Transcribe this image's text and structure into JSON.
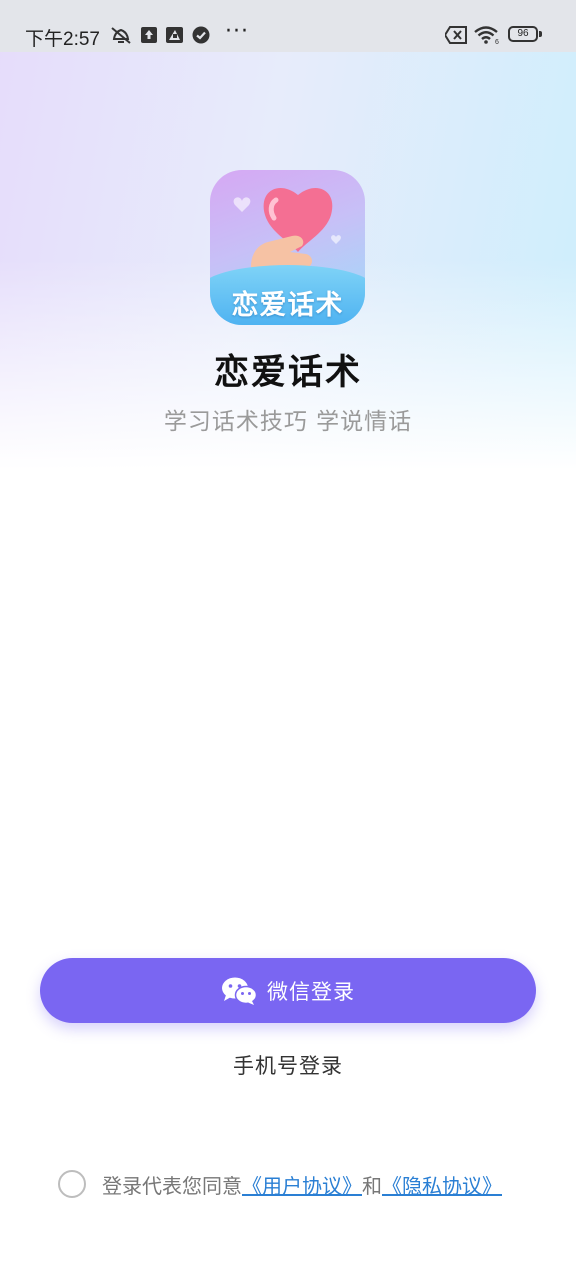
{
  "status_bar": {
    "time": "下午2:57",
    "more": "···",
    "battery": "96"
  },
  "app": {
    "logo_text": "恋爱话术",
    "name": "恋爱话术",
    "slogan": "学习话术技巧 学说情话"
  },
  "login": {
    "wechat_label": "微信登录",
    "phone_label": "手机号登录"
  },
  "agreement": {
    "prefix": "登录代表您同意",
    "user_agreement": "《用户协议》",
    "conjunction": "和",
    "privacy_agreement": "《隐私协议》"
  },
  "icons": {
    "status": [
      "mute-icon",
      "upload-icon",
      "app-notification-icon",
      "check-circle-icon",
      "sim-off-icon",
      "wifi-icon",
      "battery-icon"
    ],
    "wechat": "wechat-icon"
  },
  "colors": {
    "accent": "#7a66f2",
    "link": "#2a7fd4"
  }
}
